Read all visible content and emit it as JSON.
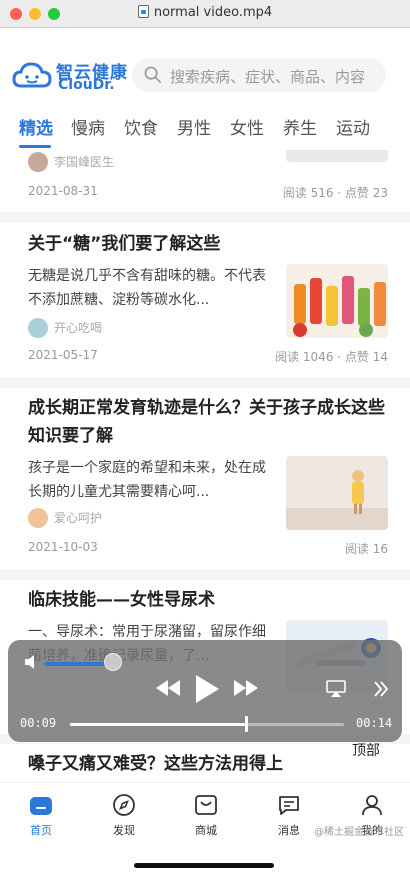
{
  "window": {
    "title": "normal video.mp4"
  },
  "header": {
    "logo_cn": "智云健康",
    "logo_en": "ClouDr.",
    "search_placeholder": "搜索疾病、症状、商品、内容",
    "tabs": [
      "精选",
      "慢病",
      "饮食",
      "男性",
      "女性",
      "养生",
      "运动"
    ],
    "active_tab": "精选"
  },
  "articles": [
    {
      "author": "李国峰医生",
      "date": "2021-08-31",
      "stats": "阅读 516 · 点赞 23"
    },
    {
      "title": "关于“糖”我们要了解这些",
      "summary": "无糖是说几乎不含有甜味的糖。不代表不添加蔗糖、淀粉等碳水化...",
      "author": "开心吃喝",
      "date": "2021-05-17",
      "stats": "阅读 1046 · 点赞 14"
    },
    {
      "title": "成长期正常发育轨迹是什么？关于孩子成长这些知识要了解",
      "summary": "孩子是一个家庭的希望和未来，处在成长期的儿童尤其需要精心呵...",
      "author": "爱心呵护",
      "date": "2021-10-03",
      "stats": "阅读 16"
    },
    {
      "title": "临床技能——女性导尿术",
      "summary": "一、导尿术：常用于尿潴留，留尿作细菌培养，准确记录尿量，了..."
    },
    {
      "title": "嗓子又痛又难受？这些方法用得上"
    }
  ],
  "player": {
    "current_time": "00:09",
    "end_time": "00:14",
    "progress": 0.64,
    "volume": 0.92
  },
  "top_button": "顶部",
  "bottom_nav": {
    "items": [
      "首页",
      "发现",
      "商城",
      "消息",
      "我的"
    ],
    "active": "首页"
  },
  "watermark": "@稀土掘金技术社区",
  "colors": {
    "brand": "#2b78d8"
  }
}
